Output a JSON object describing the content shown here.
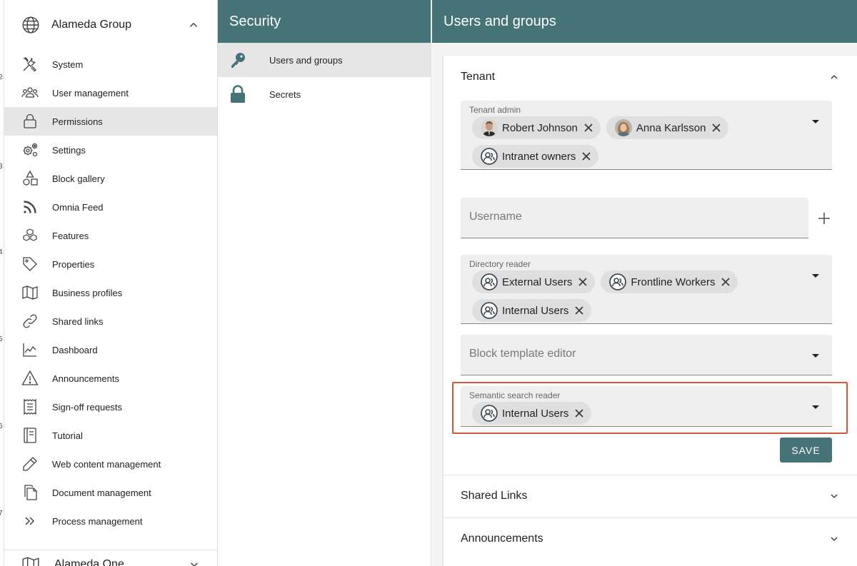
{
  "edge_numbers": [
    "2",
    "3",
    "4",
    "5",
    "6",
    "7"
  ],
  "sidebar": {
    "group_title": "Alameda Group",
    "items": [
      {
        "label": "System",
        "icon": "tools-icon"
      },
      {
        "label": "User management",
        "icon": "users-icon"
      },
      {
        "label": "Permissions",
        "icon": "lock-icon",
        "active": true
      },
      {
        "label": "Settings",
        "icon": "gears-icon"
      },
      {
        "label": "Block gallery",
        "icon": "shapes-icon"
      },
      {
        "label": "Omnia Feed",
        "icon": "rss-icon"
      },
      {
        "label": "Features",
        "icon": "cubes-icon"
      },
      {
        "label": "Properties",
        "icon": "tag-icon"
      },
      {
        "label": "Business profiles",
        "icon": "map-icon"
      },
      {
        "label": "Shared links",
        "icon": "link-icon"
      },
      {
        "label": "Dashboard",
        "icon": "chart-icon"
      },
      {
        "label": "Announcements",
        "icon": "warning-icon"
      },
      {
        "label": "Sign-off requests",
        "icon": "receipt-icon"
      },
      {
        "label": "Tutorial",
        "icon": "book-icon"
      },
      {
        "label": "Web content management",
        "icon": "pencil-icon"
      },
      {
        "label": "Document management",
        "icon": "documents-icon"
      },
      {
        "label": "Process management",
        "icon": "double-chevron-icon"
      }
    ],
    "group2_title": "Alameda One"
  },
  "security": {
    "title": "Security",
    "items": [
      {
        "label": "Users and groups",
        "icon": "key-icon",
        "active": true
      },
      {
        "label": "Secrets",
        "icon": "lock-icon"
      }
    ]
  },
  "main": {
    "title": "Users and groups",
    "tenant": {
      "title": "Tenant",
      "tenant_admin": {
        "label": "Tenant admin",
        "chips": [
          {
            "label": "Robert Johnson",
            "type": "person"
          },
          {
            "label": "Anna Karlsson",
            "type": "person"
          },
          {
            "label": "Intranet owners",
            "type": "group"
          }
        ]
      },
      "username_placeholder": "Username",
      "directory_reader": {
        "label": "Directory reader",
        "chips": [
          {
            "label": "External Users",
            "type": "group"
          },
          {
            "label": "Frontline Workers",
            "type": "group"
          },
          {
            "label": "Internal Users",
            "type": "group"
          }
        ]
      },
      "block_template_editor_placeholder": "Block template editor",
      "semantic_search_reader": {
        "label": "Semantic search reader",
        "chips": [
          {
            "label": "Internal Users",
            "type": "group"
          }
        ]
      },
      "save_label": "SAVE"
    },
    "shared_links_title": "Shared Links",
    "announcements_title": "Announcements"
  },
  "colors": {
    "header_bg": "#457377",
    "highlight": "#d9553a",
    "active_bg": "#e7e7e7"
  }
}
